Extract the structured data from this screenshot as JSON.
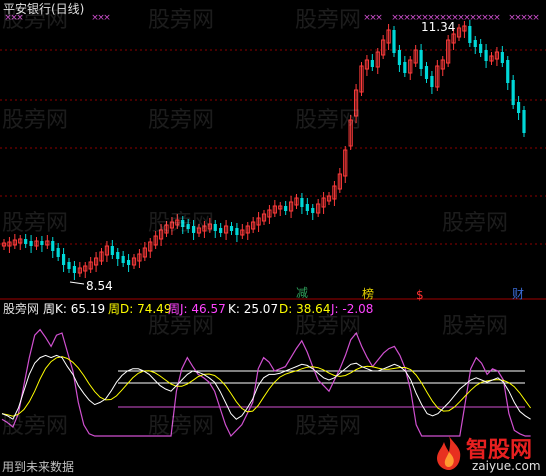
{
  "top_title": "平安银行(日线)",
  "price_high": "11.34",
  "price_low": "8.54",
  "markers": [
    "减",
    "榜",
    "$",
    "财"
  ],
  "marker_colors": [
    "#2e9e5a",
    "#e6d200",
    "#ff3030",
    "#3a6bd6"
  ],
  "indicator": {
    "name": "股旁网",
    "items": [
      {
        "label": "周K: 65.19",
        "color": "#ffffff"
      },
      {
        "label": "周D: 74.49",
        "color": "#ffff00"
      },
      {
        "label": "周J: 46.57",
        "color": "#ff44ff"
      },
      {
        "label": "K: 25.07",
        "color": "#ffffff"
      },
      {
        "label": "D: 38.64",
        "color": "#ffff00"
      },
      {
        "label": "J: -2.08",
        "color": "#ff44ff"
      }
    ]
  },
  "bottom_note": "用到未来数据",
  "watermark_text": "股旁网",
  "logo": {
    "brand": "智股网",
    "url": "zaiyue.com"
  },
  "colors": {
    "up": "#ff3b3b",
    "down": "#00d8d8",
    "grid": "#8b0000",
    "white_line": "#ffffff",
    "yellow_line": "#ffff00",
    "magenta_line": "#d050d0"
  }
}
